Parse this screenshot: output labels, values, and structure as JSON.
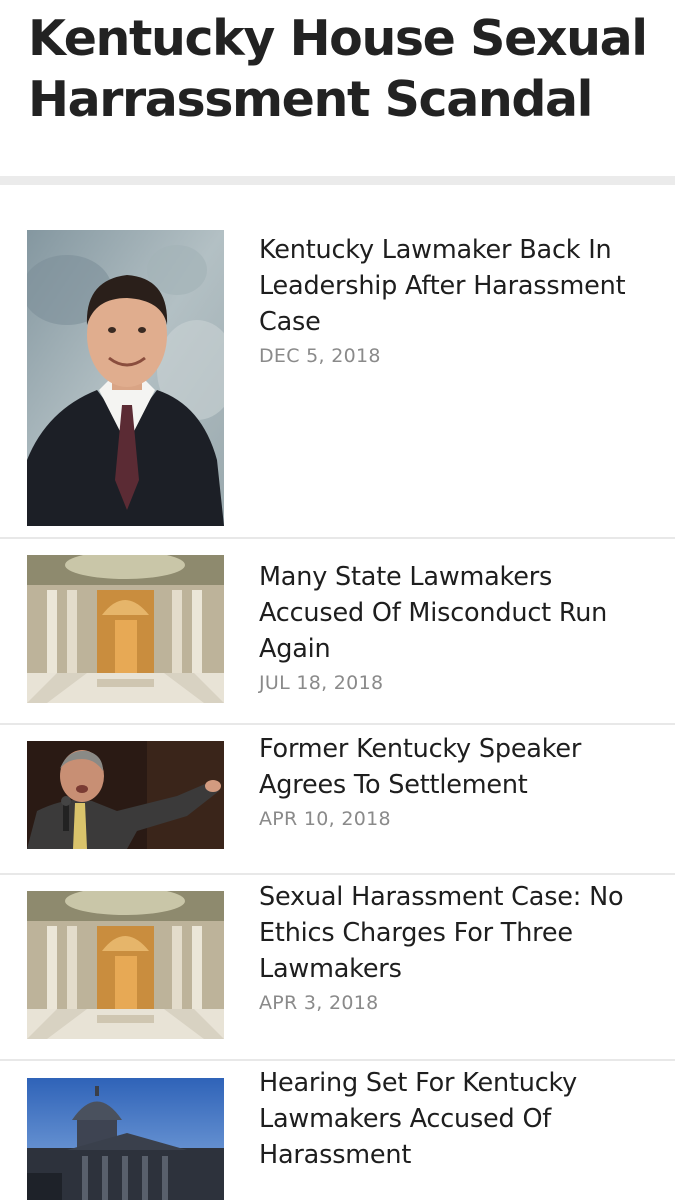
{
  "page": {
    "title": "Kentucky House Sexual Harrassment Scandal"
  },
  "articles": [
    {
      "headline": "Kentucky Lawmaker Back In Leadership After Harassment Case",
      "date": "DEC 5, 2018",
      "image": "portrait-man-in-suit"
    },
    {
      "headline": "Many State Lawmakers Accused Of Misconduct Run Again",
      "date": "JUL 18, 2018",
      "image": "capitol-rotunda-interior"
    },
    {
      "headline": "Former Kentucky Speaker Agrees To Settlement",
      "date": "APR 10, 2018",
      "image": "speaker-pointing"
    },
    {
      "headline": "Sexual Harassment Case: No Ethics Charges For Three Lawmakers",
      "date": "APR 3, 2018",
      "image": "capitol-rotunda-interior"
    },
    {
      "headline": "Hearing Set For Kentucky Lawmakers Accused Of Harassment",
      "date": "",
      "image": "capitol-building-exterior"
    }
  ]
}
